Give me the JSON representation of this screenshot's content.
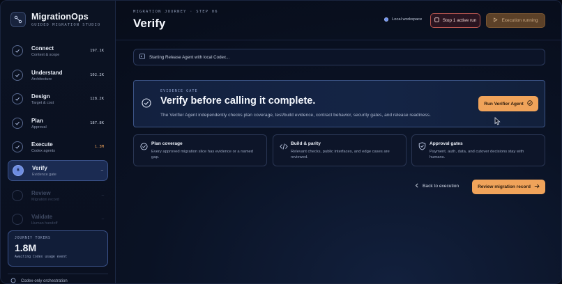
{
  "brand": {
    "title": "MigrationOps",
    "subtitle": "GUIDED MIGRATION STUDIO"
  },
  "sidebar": {
    "steps": [
      {
        "name": "Connect",
        "sub": "Context & scope",
        "value": "197.1K",
        "state": "done"
      },
      {
        "name": "Understand",
        "sub": "Architecture",
        "value": "102.2K",
        "state": "done"
      },
      {
        "name": "Design",
        "sub": "Target & cost",
        "value": "128.2K",
        "state": "done"
      },
      {
        "name": "Plan",
        "sub": "Approval",
        "value": "187.8K",
        "state": "done"
      },
      {
        "name": "Execute",
        "sub": "Codex agents",
        "value": "1.3M",
        "state": "done"
      },
      {
        "name": "Verify",
        "sub": "Evidence gate",
        "value": "–",
        "state": "active",
        "number": "6"
      },
      {
        "name": "Review",
        "sub": "Migration record",
        "value": "–",
        "state": "locked"
      },
      {
        "name": "Validate",
        "sub": "Human handoff",
        "value": "–",
        "state": "locked"
      }
    ],
    "tokens": {
      "label": "JOURNEY TOKENS",
      "value": "1.8M",
      "note": "Awaiting Codex usage event"
    },
    "footer": "Codex-only orchestration"
  },
  "header": {
    "breadcrumb": "MIGRATION JOURNEY · STEP 06",
    "title": "Verify",
    "workspace": "Local workspace",
    "stop_label": "Stop 1 active run",
    "exec_label": "Execution running"
  },
  "status_text": "Starting Release Agent with local Codex...",
  "gate": {
    "label": "EVIDENCE GATE",
    "heading": "Verify before calling it complete.",
    "description": "The Verifier Agent independently checks plan coverage, test/build evidence, contract behavior, security gates, and release readiness.",
    "button": "Run Verifier Agent"
  },
  "cards": [
    {
      "title": "Plan coverage",
      "desc": "Every approved migration slice has evidence or a named gap.",
      "icon": "check-circle-icon"
    },
    {
      "title": "Build & parity",
      "desc": "Relevant checks, public interfaces, and edge cases are reviewed.",
      "icon": "code-icon"
    },
    {
      "title": "Approval gates",
      "desc": "Payment, auth, data, and cutover decisions stay with humans.",
      "icon": "shield-check-icon"
    }
  ],
  "actions": {
    "back": "Back to execution",
    "review": "Review migration record"
  },
  "colors": {
    "accent": "#f0a35a",
    "active": "#6d8ce0",
    "stop": "#b7554f"
  }
}
